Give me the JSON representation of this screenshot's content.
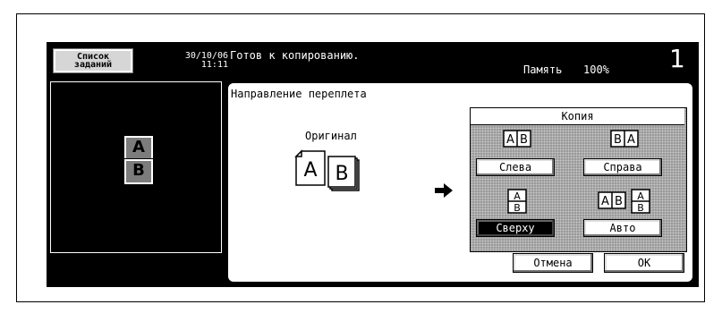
{
  "header": {
    "job_list_label": "Список заданий",
    "date": "30/10/06",
    "time": "11:11",
    "status": "Готов к копированию.",
    "memory_label": "Память",
    "memory_value": "100%",
    "copies": "1"
  },
  "preview": {
    "page1": "A",
    "page2": "B"
  },
  "panel": {
    "title": "Направление переплета",
    "original_label": "Оригинал",
    "original_pages": [
      "A",
      "B"
    ],
    "copy_header": "Копия",
    "options": [
      {
        "label": "Слева",
        "icon": "left-bind-icon",
        "selected": false
      },
      {
        "label": "Справа",
        "icon": "right-bind-icon",
        "selected": false
      },
      {
        "label": "Сверху",
        "icon": "top-bind-icon",
        "selected": true
      },
      {
        "label": "Авто",
        "icon": "auto-bind-icon",
        "selected": false
      }
    ],
    "icon_letters": {
      "a": "A",
      "b": "B"
    },
    "cancel_label": "Отмена",
    "ok_label": "OK"
  }
}
